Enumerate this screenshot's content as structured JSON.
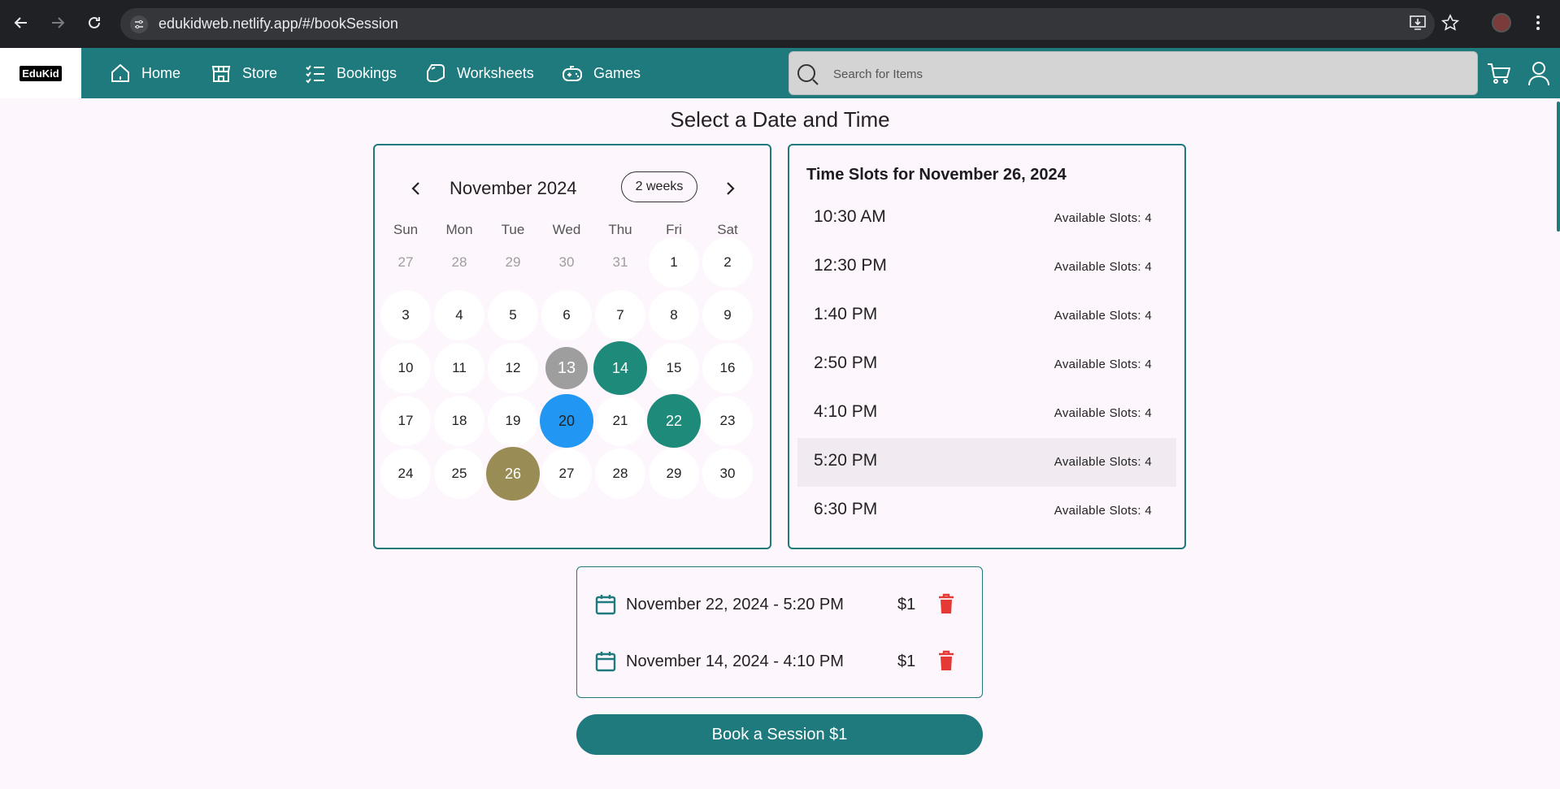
{
  "browser": {
    "url": "edukidweb.netlify.app/#/bookSession",
    "back_icon": "arrow-left-icon",
    "forward_icon": "arrow-right-icon",
    "reload_icon": "reload-icon"
  },
  "appbar": {
    "logo": "EduKid",
    "nav": [
      {
        "label": "Home",
        "icon": "home-icon"
      },
      {
        "label": "Store",
        "icon": "store-icon"
      },
      {
        "label": "Bookings",
        "icon": "checklist-icon"
      },
      {
        "label": "Worksheets",
        "icon": "pages-icon"
      },
      {
        "label": "Games",
        "icon": "gamepad-icon"
      }
    ],
    "search_placeholder": "Search for Items",
    "accent": "#1e7a7d"
  },
  "page": {
    "title": "Select a Date and Time"
  },
  "calendar": {
    "month": "November 2024",
    "format_button": "2 weeks",
    "weekdays": [
      "Sun",
      "Mon",
      "Tue",
      "Wed",
      "Thu",
      "Fri",
      "Sat"
    ],
    "weeks": [
      [
        {
          "d": "27",
          "s": "muted"
        },
        {
          "d": "28",
          "s": "muted"
        },
        {
          "d": "29",
          "s": "muted"
        },
        {
          "d": "30",
          "s": "muted"
        },
        {
          "d": "31",
          "s": "muted"
        },
        {
          "d": "1",
          "s": ""
        },
        {
          "d": "2",
          "s": ""
        }
      ],
      [
        {
          "d": "3",
          "s": ""
        },
        {
          "d": "4",
          "s": ""
        },
        {
          "d": "5",
          "s": ""
        },
        {
          "d": "6",
          "s": ""
        },
        {
          "d": "7",
          "s": ""
        },
        {
          "d": "8",
          "s": ""
        },
        {
          "d": "9",
          "s": ""
        }
      ],
      [
        {
          "d": "10",
          "s": ""
        },
        {
          "d": "11",
          "s": ""
        },
        {
          "d": "12",
          "s": ""
        },
        {
          "d": "13",
          "s": "disabled"
        },
        {
          "d": "14",
          "s": "booked"
        },
        {
          "d": "15",
          "s": ""
        },
        {
          "d": "16",
          "s": ""
        }
      ],
      [
        {
          "d": "17",
          "s": ""
        },
        {
          "d": "18",
          "s": ""
        },
        {
          "d": "19",
          "s": ""
        },
        {
          "d": "20",
          "s": "today"
        },
        {
          "d": "21",
          "s": ""
        },
        {
          "d": "22",
          "s": "booked"
        },
        {
          "d": "23",
          "s": ""
        }
      ],
      [
        {
          "d": "24",
          "s": ""
        },
        {
          "d": "25",
          "s": ""
        },
        {
          "d": "26",
          "s": "selected"
        },
        {
          "d": "27",
          "s": ""
        },
        {
          "d": "28",
          "s": ""
        },
        {
          "d": "29",
          "s": ""
        },
        {
          "d": "30",
          "s": ""
        }
      ]
    ],
    "colors": {
      "booked": "#1e8a7a",
      "today": "#2196f3",
      "selected": "#9a8c55",
      "disabled": "#9e9e9e"
    }
  },
  "slots": {
    "title": "Time Slots for November 26, 2024",
    "items": [
      {
        "time": "10:30 AM",
        "available": "Available Slots: 4"
      },
      {
        "time": "12:30 PM",
        "available": "Available Slots: 4"
      },
      {
        "time": "1:40 PM",
        "available": "Available Slots: 4"
      },
      {
        "time": "2:50 PM",
        "available": "Available Slots: 4"
      },
      {
        "time": "4:10 PM",
        "available": "Available Slots: 4"
      },
      {
        "time": "5:20 PM",
        "available": "Available Slots: 4"
      },
      {
        "time": "6:30 PM",
        "available": "Available Slots: 4"
      }
    ],
    "highlighted_index": 5
  },
  "bookings": [
    {
      "label": "November 22, 2024 - 5:20 PM",
      "price": "$1"
    },
    {
      "label": "November 14, 2024 - 4:10 PM",
      "price": "$1"
    }
  ],
  "book_button": "Book a Session $1"
}
